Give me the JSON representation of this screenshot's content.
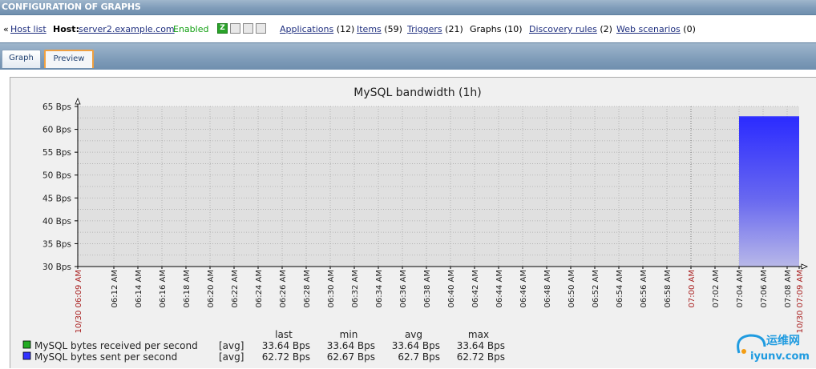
{
  "page": {
    "title": "CONFIGURATION OF GRAPHS"
  },
  "hostbar": {
    "back_marker": "«",
    "host_list": "Host list",
    "host_label": "Host:",
    "host_name": "server2.example.com",
    "status": "Enabled",
    "availability": [
      "Z",
      "",
      "",
      ""
    ],
    "links": [
      {
        "label": "Applications",
        "count": "(12)",
        "link": true
      },
      {
        "label": "Items",
        "count": "(59)",
        "link": true
      },
      {
        "label": "Triggers",
        "count": "(21)",
        "link": true
      },
      {
        "label": "Graphs",
        "count": "(10)",
        "link": false
      },
      {
        "label": "Discovery rules",
        "count": "(2)",
        "link": true
      },
      {
        "label": "Web scenarios",
        "count": "(0)",
        "link": true
      }
    ]
  },
  "tabs": [
    {
      "label": "Graph",
      "active": false
    },
    {
      "label": "Preview",
      "active": true
    }
  ],
  "watermark": {
    "line1": "运维网",
    "line2": "iyunv.com"
  },
  "colors": {
    "received": "#22aa22",
    "sent": "#3333ff",
    "grid": "#999999",
    "time_red": "#aa2222",
    "frame_bg": "#f0f0f0",
    "plot_bg": "#e0e0e0"
  },
  "chart_data": {
    "type": "area",
    "title": "MySQL bandwidth (1h)",
    "ylim": [
      30,
      65
    ],
    "yticks": [
      30,
      35,
      40,
      45,
      50,
      55,
      60,
      65
    ],
    "y_unit": "Bps",
    "x_start_label": "10/30 06:09 AM",
    "x_end_label": "10/30 07:09 AM",
    "xticks": [
      "06:12 AM",
      "06:14 AM",
      "06:16 AM",
      "06:18 AM",
      "06:20 AM",
      "06:22 AM",
      "06:24 AM",
      "06:26 AM",
      "06:28 AM",
      "06:30 AM",
      "06:32 AM",
      "06:34 AM",
      "06:36 AM",
      "06:38 AM",
      "06:40 AM",
      "06:42 AM",
      "06:44 AM",
      "06:46 AM",
      "06:48 AM",
      "06:50 AM",
      "06:52 AM",
      "06:54 AM",
      "06:56 AM",
      "06:58 AM",
      "07:00 AM",
      "07:02 AM",
      "07:04 AM",
      "07:06 AM",
      "07:08 AM"
    ],
    "highlight_ticks": [
      "07:00 AM"
    ],
    "grid": true,
    "series": [
      {
        "name": "MySQL bytes received per second",
        "color": "#22aa22",
        "start": "07:04 AM",
        "end": "07:09 AM",
        "value": 33.64,
        "func": "[avg]",
        "last": "33.64 Bps",
        "min": "33.64 Bps",
        "avg": "33.64 Bps",
        "max": "33.64 Bps"
      },
      {
        "name": "MySQL bytes sent per second",
        "color": "#3333ff",
        "start": "07:04 AM",
        "end": "07:09 AM",
        "value": 62.72,
        "func": "[avg]",
        "last": "62.72 Bps",
        "min": "62.67 Bps",
        "avg": "62.7 Bps",
        "max": "62.72 Bps"
      }
    ],
    "legend_headers": [
      "last",
      "min",
      "avg",
      "max"
    ]
  }
}
